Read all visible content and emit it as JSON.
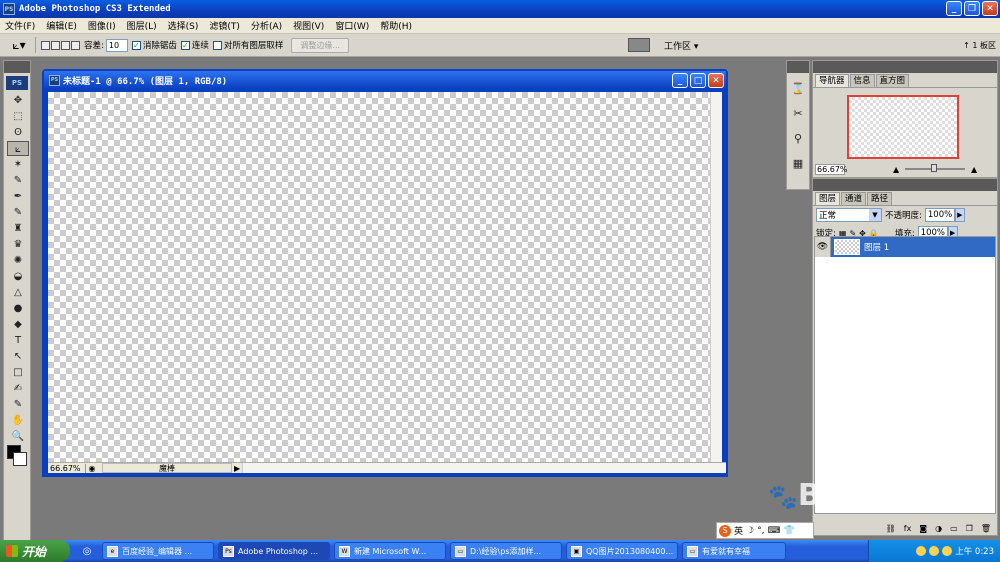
{
  "app": {
    "title": "Adobe Photoshop CS3 Extended",
    "icon": "PS"
  },
  "menu": [
    "文件(F)",
    "编辑(E)",
    "图像(I)",
    "图层(L)",
    "选择(S)",
    "滤镜(T)",
    "分析(A)",
    "视图(V)",
    "窗口(W)",
    "帮助(H)"
  ],
  "options": {
    "tool_icon": "magic-wand-icon",
    "tolerance_label": "容差:",
    "tolerance_value": "10",
    "anti_alias_label": "消除锯齿",
    "contiguous_label": "连续",
    "sample_all_label": "对所有图层取样",
    "refine_edge_label": "调整边缘...",
    "workspace_label": "工作区 ▾",
    "right_label": "↑ 1 板区"
  },
  "tools": [
    "✥",
    "⬚",
    "ʘ",
    "✶",
    "⟀",
    "✎",
    "✒",
    "♜",
    "♛",
    "✺",
    "◒",
    "●",
    "△",
    "◆",
    "T",
    "↖",
    "□",
    "✍",
    "✋",
    "🔍"
  ],
  "document": {
    "title": "未标题-1 @ 66.7% (图层 1, RGB/8)",
    "zoom": "66.67%",
    "status_info": "魔棒"
  },
  "navigator": {
    "tabs": [
      "导航器",
      "信息",
      "直方图"
    ],
    "zoom": "66.67%"
  },
  "layers": {
    "tabs": [
      "图层",
      "通道",
      "路径"
    ],
    "blend_mode": "正常",
    "opacity_label": "不透明度:",
    "opacity_value": "100%",
    "lock_label": "锁定:",
    "fill_label": "填充:",
    "fill_value": "100%",
    "items": [
      {
        "name": "图层 1",
        "visible": true,
        "selected": true
      }
    ]
  },
  "ime": {
    "label": "英"
  },
  "taskbar": {
    "start_label": "开始",
    "items": [
      {
        "label": "百度经验_编辑器 ...",
        "active": false
      },
      {
        "label": "Adobe Photoshop ...",
        "active": true
      },
      {
        "label": "新建 Microsoft W...",
        "active": false
      },
      {
        "label": "D:\\经验\\ps添加样...",
        "active": false
      },
      {
        "label": "QQ图片2013080400...",
        "active": false
      },
      {
        "label": "有爱就有幸福",
        "active": false
      }
    ],
    "time": "上午 0:23"
  },
  "watermark": "Baidu经验"
}
